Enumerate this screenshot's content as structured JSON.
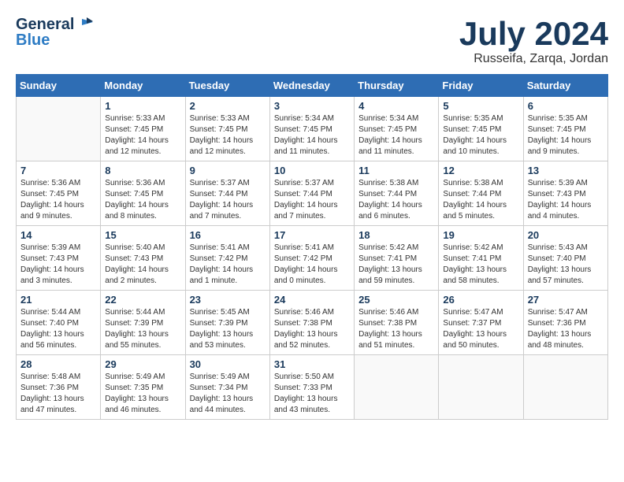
{
  "logo": {
    "text_general": "General",
    "text_blue": "Blue"
  },
  "title": {
    "month_year": "July 2024",
    "location": "Russeifa, Zarqa, Jordan"
  },
  "headers": [
    "Sunday",
    "Monday",
    "Tuesday",
    "Wednesday",
    "Thursday",
    "Friday",
    "Saturday"
  ],
  "weeks": [
    [
      {
        "day": "",
        "sunrise": "",
        "sunset": "",
        "daylight": ""
      },
      {
        "day": "1",
        "sunrise": "Sunrise: 5:33 AM",
        "sunset": "Sunset: 7:45 PM",
        "daylight": "Daylight: 14 hours and 12 minutes."
      },
      {
        "day": "2",
        "sunrise": "Sunrise: 5:33 AM",
        "sunset": "Sunset: 7:45 PM",
        "daylight": "Daylight: 14 hours and 12 minutes."
      },
      {
        "day": "3",
        "sunrise": "Sunrise: 5:34 AM",
        "sunset": "Sunset: 7:45 PM",
        "daylight": "Daylight: 14 hours and 11 minutes."
      },
      {
        "day": "4",
        "sunrise": "Sunrise: 5:34 AM",
        "sunset": "Sunset: 7:45 PM",
        "daylight": "Daylight: 14 hours and 11 minutes."
      },
      {
        "day": "5",
        "sunrise": "Sunrise: 5:35 AM",
        "sunset": "Sunset: 7:45 PM",
        "daylight": "Daylight: 14 hours and 10 minutes."
      },
      {
        "day": "6",
        "sunrise": "Sunrise: 5:35 AM",
        "sunset": "Sunset: 7:45 PM",
        "daylight": "Daylight: 14 hours and 9 minutes."
      }
    ],
    [
      {
        "day": "7",
        "sunrise": "Sunrise: 5:36 AM",
        "sunset": "Sunset: 7:45 PM",
        "daylight": "Daylight: 14 hours and 9 minutes."
      },
      {
        "day": "8",
        "sunrise": "Sunrise: 5:36 AM",
        "sunset": "Sunset: 7:45 PM",
        "daylight": "Daylight: 14 hours and 8 minutes."
      },
      {
        "day": "9",
        "sunrise": "Sunrise: 5:37 AM",
        "sunset": "Sunset: 7:44 PM",
        "daylight": "Daylight: 14 hours and 7 minutes."
      },
      {
        "day": "10",
        "sunrise": "Sunrise: 5:37 AM",
        "sunset": "Sunset: 7:44 PM",
        "daylight": "Daylight: 14 hours and 7 minutes."
      },
      {
        "day": "11",
        "sunrise": "Sunrise: 5:38 AM",
        "sunset": "Sunset: 7:44 PM",
        "daylight": "Daylight: 14 hours and 6 minutes."
      },
      {
        "day": "12",
        "sunrise": "Sunrise: 5:38 AM",
        "sunset": "Sunset: 7:44 PM",
        "daylight": "Daylight: 14 hours and 5 minutes."
      },
      {
        "day": "13",
        "sunrise": "Sunrise: 5:39 AM",
        "sunset": "Sunset: 7:43 PM",
        "daylight": "Daylight: 14 hours and 4 minutes."
      }
    ],
    [
      {
        "day": "14",
        "sunrise": "Sunrise: 5:39 AM",
        "sunset": "Sunset: 7:43 PM",
        "daylight": "Daylight: 14 hours and 3 minutes."
      },
      {
        "day": "15",
        "sunrise": "Sunrise: 5:40 AM",
        "sunset": "Sunset: 7:43 PM",
        "daylight": "Daylight: 14 hours and 2 minutes."
      },
      {
        "day": "16",
        "sunrise": "Sunrise: 5:41 AM",
        "sunset": "Sunset: 7:42 PM",
        "daylight": "Daylight: 14 hours and 1 minute."
      },
      {
        "day": "17",
        "sunrise": "Sunrise: 5:41 AM",
        "sunset": "Sunset: 7:42 PM",
        "daylight": "Daylight: 14 hours and 0 minutes."
      },
      {
        "day": "18",
        "sunrise": "Sunrise: 5:42 AM",
        "sunset": "Sunset: 7:41 PM",
        "daylight": "Daylight: 13 hours and 59 minutes."
      },
      {
        "day": "19",
        "sunrise": "Sunrise: 5:42 AM",
        "sunset": "Sunset: 7:41 PM",
        "daylight": "Daylight: 13 hours and 58 minutes."
      },
      {
        "day": "20",
        "sunrise": "Sunrise: 5:43 AM",
        "sunset": "Sunset: 7:40 PM",
        "daylight": "Daylight: 13 hours and 57 minutes."
      }
    ],
    [
      {
        "day": "21",
        "sunrise": "Sunrise: 5:44 AM",
        "sunset": "Sunset: 7:40 PM",
        "daylight": "Daylight: 13 hours and 56 minutes."
      },
      {
        "day": "22",
        "sunrise": "Sunrise: 5:44 AM",
        "sunset": "Sunset: 7:39 PM",
        "daylight": "Daylight: 13 hours and 55 minutes."
      },
      {
        "day": "23",
        "sunrise": "Sunrise: 5:45 AM",
        "sunset": "Sunset: 7:39 PM",
        "daylight": "Daylight: 13 hours and 53 minutes."
      },
      {
        "day": "24",
        "sunrise": "Sunrise: 5:46 AM",
        "sunset": "Sunset: 7:38 PM",
        "daylight": "Daylight: 13 hours and 52 minutes."
      },
      {
        "day": "25",
        "sunrise": "Sunrise: 5:46 AM",
        "sunset": "Sunset: 7:38 PM",
        "daylight": "Daylight: 13 hours and 51 minutes."
      },
      {
        "day": "26",
        "sunrise": "Sunrise: 5:47 AM",
        "sunset": "Sunset: 7:37 PM",
        "daylight": "Daylight: 13 hours and 50 minutes."
      },
      {
        "day": "27",
        "sunrise": "Sunrise: 5:47 AM",
        "sunset": "Sunset: 7:36 PM",
        "daylight": "Daylight: 13 hours and 48 minutes."
      }
    ],
    [
      {
        "day": "28",
        "sunrise": "Sunrise: 5:48 AM",
        "sunset": "Sunset: 7:36 PM",
        "daylight": "Daylight: 13 hours and 47 minutes."
      },
      {
        "day": "29",
        "sunrise": "Sunrise: 5:49 AM",
        "sunset": "Sunset: 7:35 PM",
        "daylight": "Daylight: 13 hours and 46 minutes."
      },
      {
        "day": "30",
        "sunrise": "Sunrise: 5:49 AM",
        "sunset": "Sunset: 7:34 PM",
        "daylight": "Daylight: 13 hours and 44 minutes."
      },
      {
        "day": "31",
        "sunrise": "Sunrise: 5:50 AM",
        "sunset": "Sunset: 7:33 PM",
        "daylight": "Daylight: 13 hours and 43 minutes."
      },
      {
        "day": "",
        "sunrise": "",
        "sunset": "",
        "daylight": ""
      },
      {
        "day": "",
        "sunrise": "",
        "sunset": "",
        "daylight": ""
      },
      {
        "day": "",
        "sunrise": "",
        "sunset": "",
        "daylight": ""
      }
    ]
  ]
}
